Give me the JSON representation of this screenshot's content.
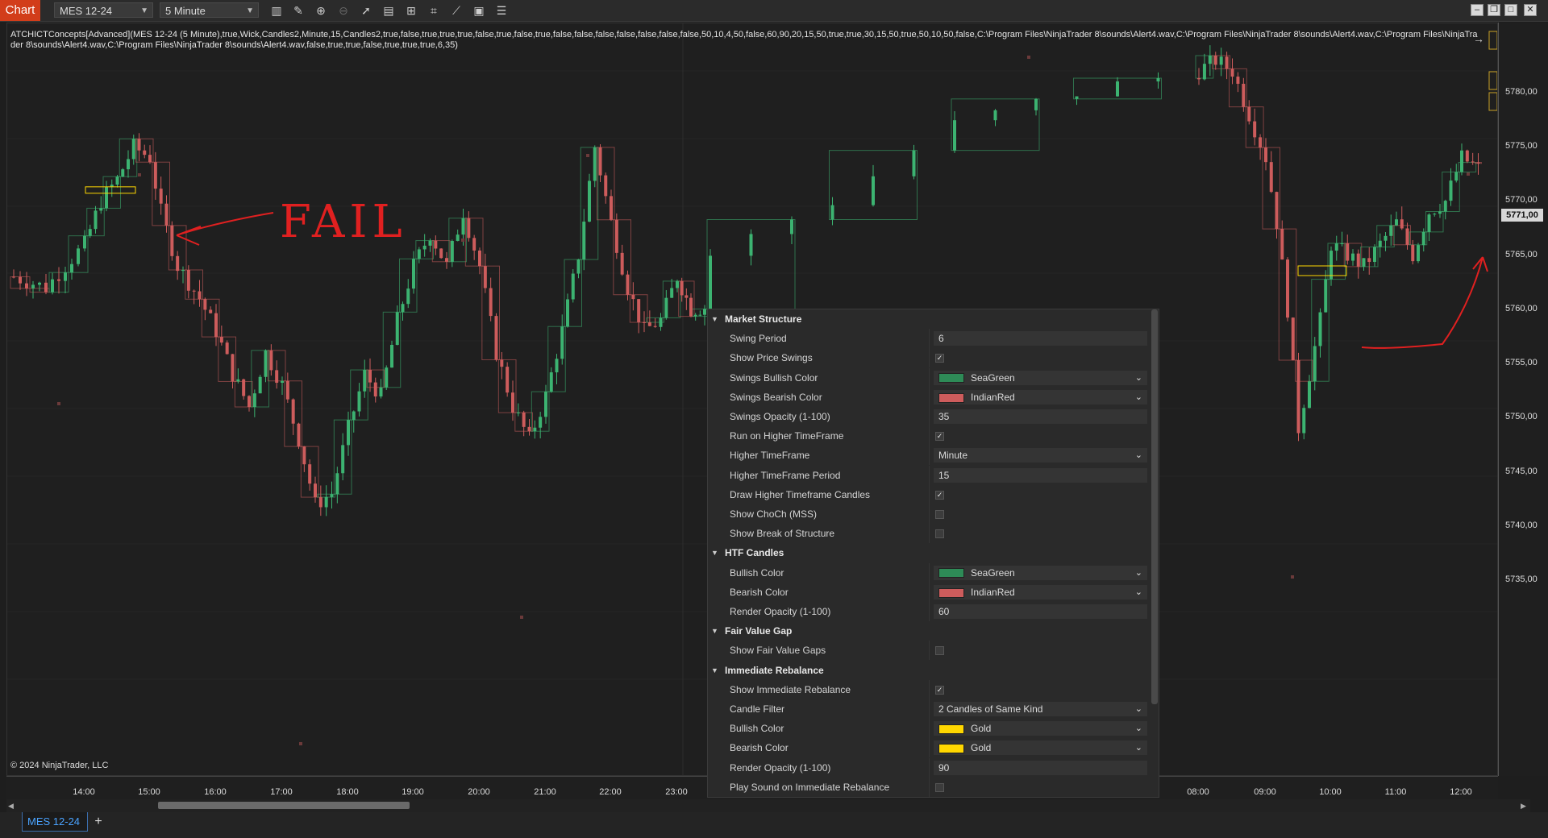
{
  "toolbar": {
    "chart_tab": "Chart",
    "instrument": "MES 12-24",
    "interval": "5 Minute",
    "icons": [
      "bars-type-icon",
      "draw-tool-icon",
      "zoom-in-icon",
      "zoom-out-icon",
      "pointer-icon",
      "data-box-icon",
      "strategy-icon",
      "indicators-icon",
      "properties-icon",
      "list-icon"
    ]
  },
  "window_controls": [
    "minimize",
    "restore",
    "maximize",
    "close"
  ],
  "indicator_label": "ATCHICTConcepts[Advanced](MES 12-24 (5 Minute),true,Wick,Candles2,Minute,15,Candles2,true,false,true,true,true,false,true,false,true,false,false,false,false,false,false,false,50,10,4,50,false,60,90,20,15,50,true,true,30,15,50,true,50,10,50,false,C:\\Program Files\\NinjaTrader 8\\sounds\\Alert4.wav,C:\\Program Files\\NinjaTrader 8\\sounds\\Alert4.wav,C:\\Program Files\\NinjaTrader 8\\sounds\\Alert4.wav,C:\\Program Files\\NinjaTrader 8\\sounds\\Alert4.wav,false,true,true,false,true,true,true,6,35)",
  "copyright": "© 2024 NinjaTrader, LLC",
  "price_axis": {
    "labels": [
      "5780,00",
      "5775,00",
      "5770,00",
      "5765,00",
      "5760,00",
      "5755,00",
      "5750,00",
      "5745,00",
      "5740,00",
      "5735,00"
    ],
    "current_price": "5771,00"
  },
  "time_axis": {
    "labels": [
      "14:00",
      "15:00",
      "16:00",
      "17:00",
      "18:00",
      "19:00",
      "20:00",
      "21:00",
      "22:00",
      "23:00",
      "08:00",
      "09:00",
      "10:00",
      "11:00",
      "12:00"
    ]
  },
  "annotations": {
    "fail_text": "FAIL"
  },
  "chart_data": {
    "type": "candlestick",
    "instrument": "MES 12-24",
    "interval": "5 Minute",
    "ylim": [
      5732,
      5785
    ],
    "colors": {
      "bull": "#3cb371",
      "bear": "#cd5c5c",
      "rebalance": "#ffd700"
    },
    "close_path": [
      [
        "13:05",
        5761
      ],
      [
        "13:30",
        5760
      ],
      [
        "13:45",
        5762
      ],
      [
        "14:00",
        5764
      ],
      [
        "14:15",
        5768
      ],
      [
        "14:30",
        5770
      ],
      [
        "14:45",
        5773
      ],
      [
        "15:00",
        5772
      ],
      [
        "15:10",
        5767
      ],
      [
        "15:25",
        5762
      ],
      [
        "15:45",
        5759
      ],
      [
        "16:00",
        5756
      ],
      [
        "16:15",
        5752
      ],
      [
        "16:30",
        5749
      ],
      [
        "16:45",
        5754
      ],
      [
        "17:00",
        5751
      ],
      [
        "17:15",
        5746
      ],
      [
        "17:30",
        5740
      ],
      [
        "17:45",
        5741
      ],
      [
        "18:00",
        5747
      ],
      [
        "18:15",
        5752
      ],
      [
        "18:30",
        5750
      ],
      [
        "18:45",
        5757
      ],
      [
        "19:00",
        5762
      ],
      [
        "19:15",
        5765
      ],
      [
        "19:30",
        5762
      ],
      [
        "19:45",
        5767
      ],
      [
        "20:00",
        5762
      ],
      [
        "20:15",
        5754
      ],
      [
        "20:30",
        5749
      ],
      [
        "20:45",
        5746
      ],
      [
        "21:00",
        5750
      ],
      [
        "21:15",
        5756
      ],
      [
        "21:30",
        5763
      ],
      [
        "21:45",
        5773
      ],
      [
        "22:00",
        5766
      ],
      [
        "22:15",
        5760
      ],
      [
        "22:30",
        5756
      ],
      [
        "22:45",
        5757
      ],
      [
        "23:00",
        5761
      ],
      [
        "23:15",
        5758
      ],
      [
        "07:00",
        5763
      ],
      [
        "07:15",
        5768
      ],
      [
        "07:30",
        5775
      ],
      [
        "07:45",
        5778
      ],
      [
        "08:00",
        5780
      ],
      [
        "08:15",
        5781
      ],
      [
        "08:30",
        5780
      ],
      [
        "08:45",
        5776
      ],
      [
        "09:00",
        5772
      ],
      [
        "09:10",
        5766
      ],
      [
        "09:20",
        5758
      ],
      [
        "09:30",
        5747
      ],
      [
        "09:40",
        5752
      ],
      [
        "09:50",
        5757
      ],
      [
        "10:00",
        5764
      ],
      [
        "10:15",
        5763
      ],
      [
        "10:30",
        5762
      ],
      [
        "10:45",
        5764
      ],
      [
        "11:00",
        5766
      ],
      [
        "11:15",
        5763
      ],
      [
        "11:30",
        5767
      ],
      [
        "11:45",
        5768
      ],
      [
        "12:00",
        5772
      ],
      [
        "12:15",
        5771
      ]
    ]
  },
  "properties": {
    "sections": [
      {
        "title": "Market Structure",
        "rows": [
          {
            "label": "Swing Period",
            "kind": "text",
            "value": "6"
          },
          {
            "label": "Show Price Swings",
            "kind": "check",
            "checked": true
          },
          {
            "label": "Swings Bullish Color",
            "kind": "color",
            "value": "SeaGreen",
            "color": "#2e8b57"
          },
          {
            "label": "Swings Bearish Color",
            "kind": "color",
            "value": "IndianRed",
            "color": "#cd5c5c"
          },
          {
            "label": "Swings Opacity (1-100)",
            "kind": "text",
            "value": "35"
          },
          {
            "label": "Run on Higher TimeFrame",
            "kind": "check",
            "checked": true
          },
          {
            "label": "Higher TimeFrame",
            "kind": "select",
            "value": "Minute"
          },
          {
            "label": "Higher TimeFrame Period",
            "kind": "text",
            "value": "15"
          },
          {
            "label": "Draw Higher Timeframe Candles",
            "kind": "check",
            "checked": true
          },
          {
            "label": "Show ChoCh (MSS)",
            "kind": "check",
            "checked": false
          },
          {
            "label": "Show Break of Structure",
            "kind": "check",
            "checked": false
          }
        ]
      },
      {
        "title": "HTF Candles",
        "rows": [
          {
            "label": "Bullish Color",
            "kind": "color",
            "value": "SeaGreen",
            "color": "#2e8b57"
          },
          {
            "label": "Bearish Color",
            "kind": "color",
            "value": "IndianRed",
            "color": "#cd5c5c"
          },
          {
            "label": "Render Opacity (1-100)",
            "kind": "text",
            "value": "60"
          }
        ]
      },
      {
        "title": "Fair Value Gap",
        "rows": [
          {
            "label": "Show Fair Value Gaps",
            "kind": "check",
            "checked": false
          }
        ]
      },
      {
        "title": "Immediate Rebalance",
        "rows": [
          {
            "label": "Show Immediate Rebalance",
            "kind": "check",
            "checked": true
          },
          {
            "label": "Candle Filter",
            "kind": "select",
            "value": "2 Candles of Same Kind"
          },
          {
            "label": "Bullish Color",
            "kind": "color",
            "value": "Gold",
            "color": "#ffd700"
          },
          {
            "label": "Bearish Color",
            "kind": "color",
            "value": "Gold",
            "color": "#ffd700"
          },
          {
            "label": "Render Opacity (1-100)",
            "kind": "text",
            "value": "90"
          },
          {
            "label": "Play Sound on Immediate Rebalance",
            "kind": "check",
            "checked": false
          }
        ]
      }
    ]
  },
  "bottom_tabs": {
    "active": "MES 12-24",
    "add": "+"
  }
}
